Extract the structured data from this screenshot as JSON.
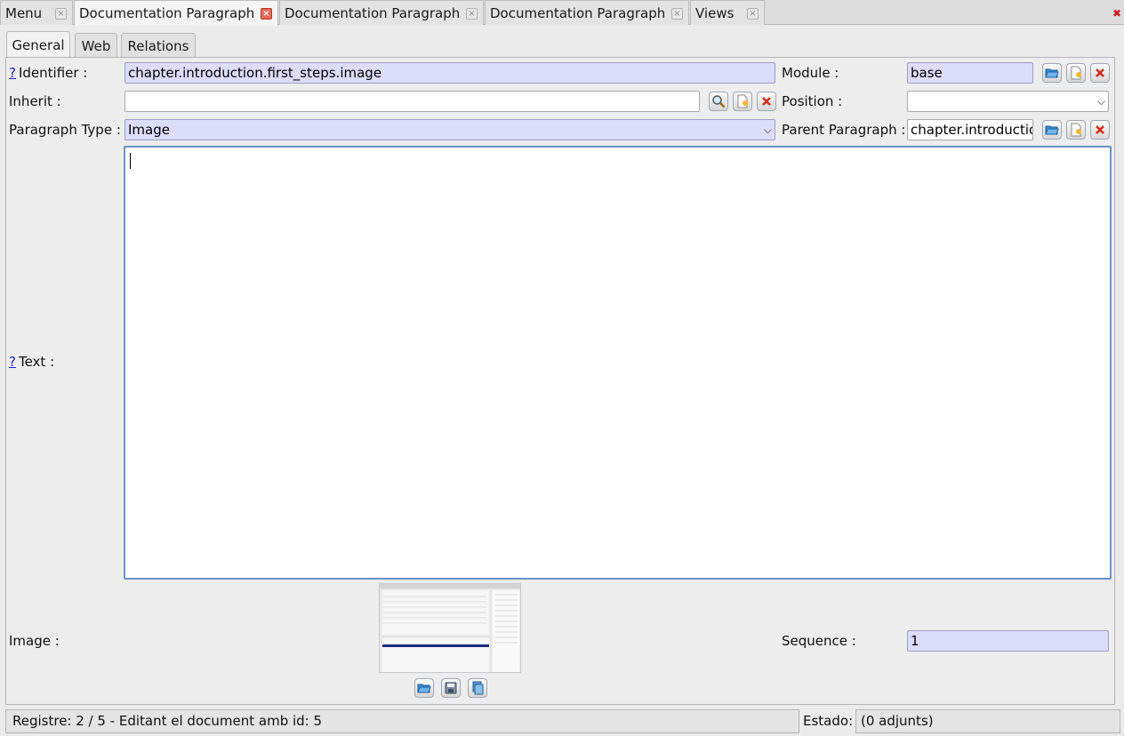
{
  "doc_tabs": [
    {
      "label": "Menu"
    },
    {
      "label": "Documentation Paragraph"
    },
    {
      "label": "Documentation Paragraph"
    },
    {
      "label": "Documentation Paragraph"
    },
    {
      "label": "Views"
    }
  ],
  "tab_close_glyph": "×",
  "window_close_glyph": "✖",
  "sub_tabs": [
    {
      "label": "General"
    },
    {
      "label": "Web"
    },
    {
      "label": "Relations"
    }
  ],
  "help_glyph": "?",
  "form": {
    "identifier": {
      "label": "Identifier :",
      "value": "chapter.introduction.first_steps.image"
    },
    "module": {
      "label": "Module :",
      "value": "base"
    },
    "inherit": {
      "label": "Inherit :",
      "value": ""
    },
    "position": {
      "label": "Position :",
      "value": ""
    },
    "paragraph_type": {
      "label": "Paragraph Type :",
      "value": "Image"
    },
    "parent_paragraph": {
      "label": "Parent Paragraph :",
      "value": "chapter.introduction"
    },
    "text": {
      "label": "Text :",
      "value": ""
    },
    "image": {
      "label": "Image :"
    },
    "sequence": {
      "label": "Sequence :",
      "value": "1"
    }
  },
  "status": {
    "record": "Registre: 2 / 5 - Editant el document amb id: 5",
    "state_label": "Estado:",
    "state_value": "(0 adjunts)"
  },
  "colors": {
    "required_field": "#dcdcfb",
    "active_tab_close": "#e66a57",
    "focus_border": "#6a93c9"
  },
  "icons": {
    "open": "folder-open-icon",
    "new": "new-document-icon",
    "clear": "clear-icon",
    "search": "search-icon",
    "save": "save-icon",
    "copy": "copy-icon"
  }
}
